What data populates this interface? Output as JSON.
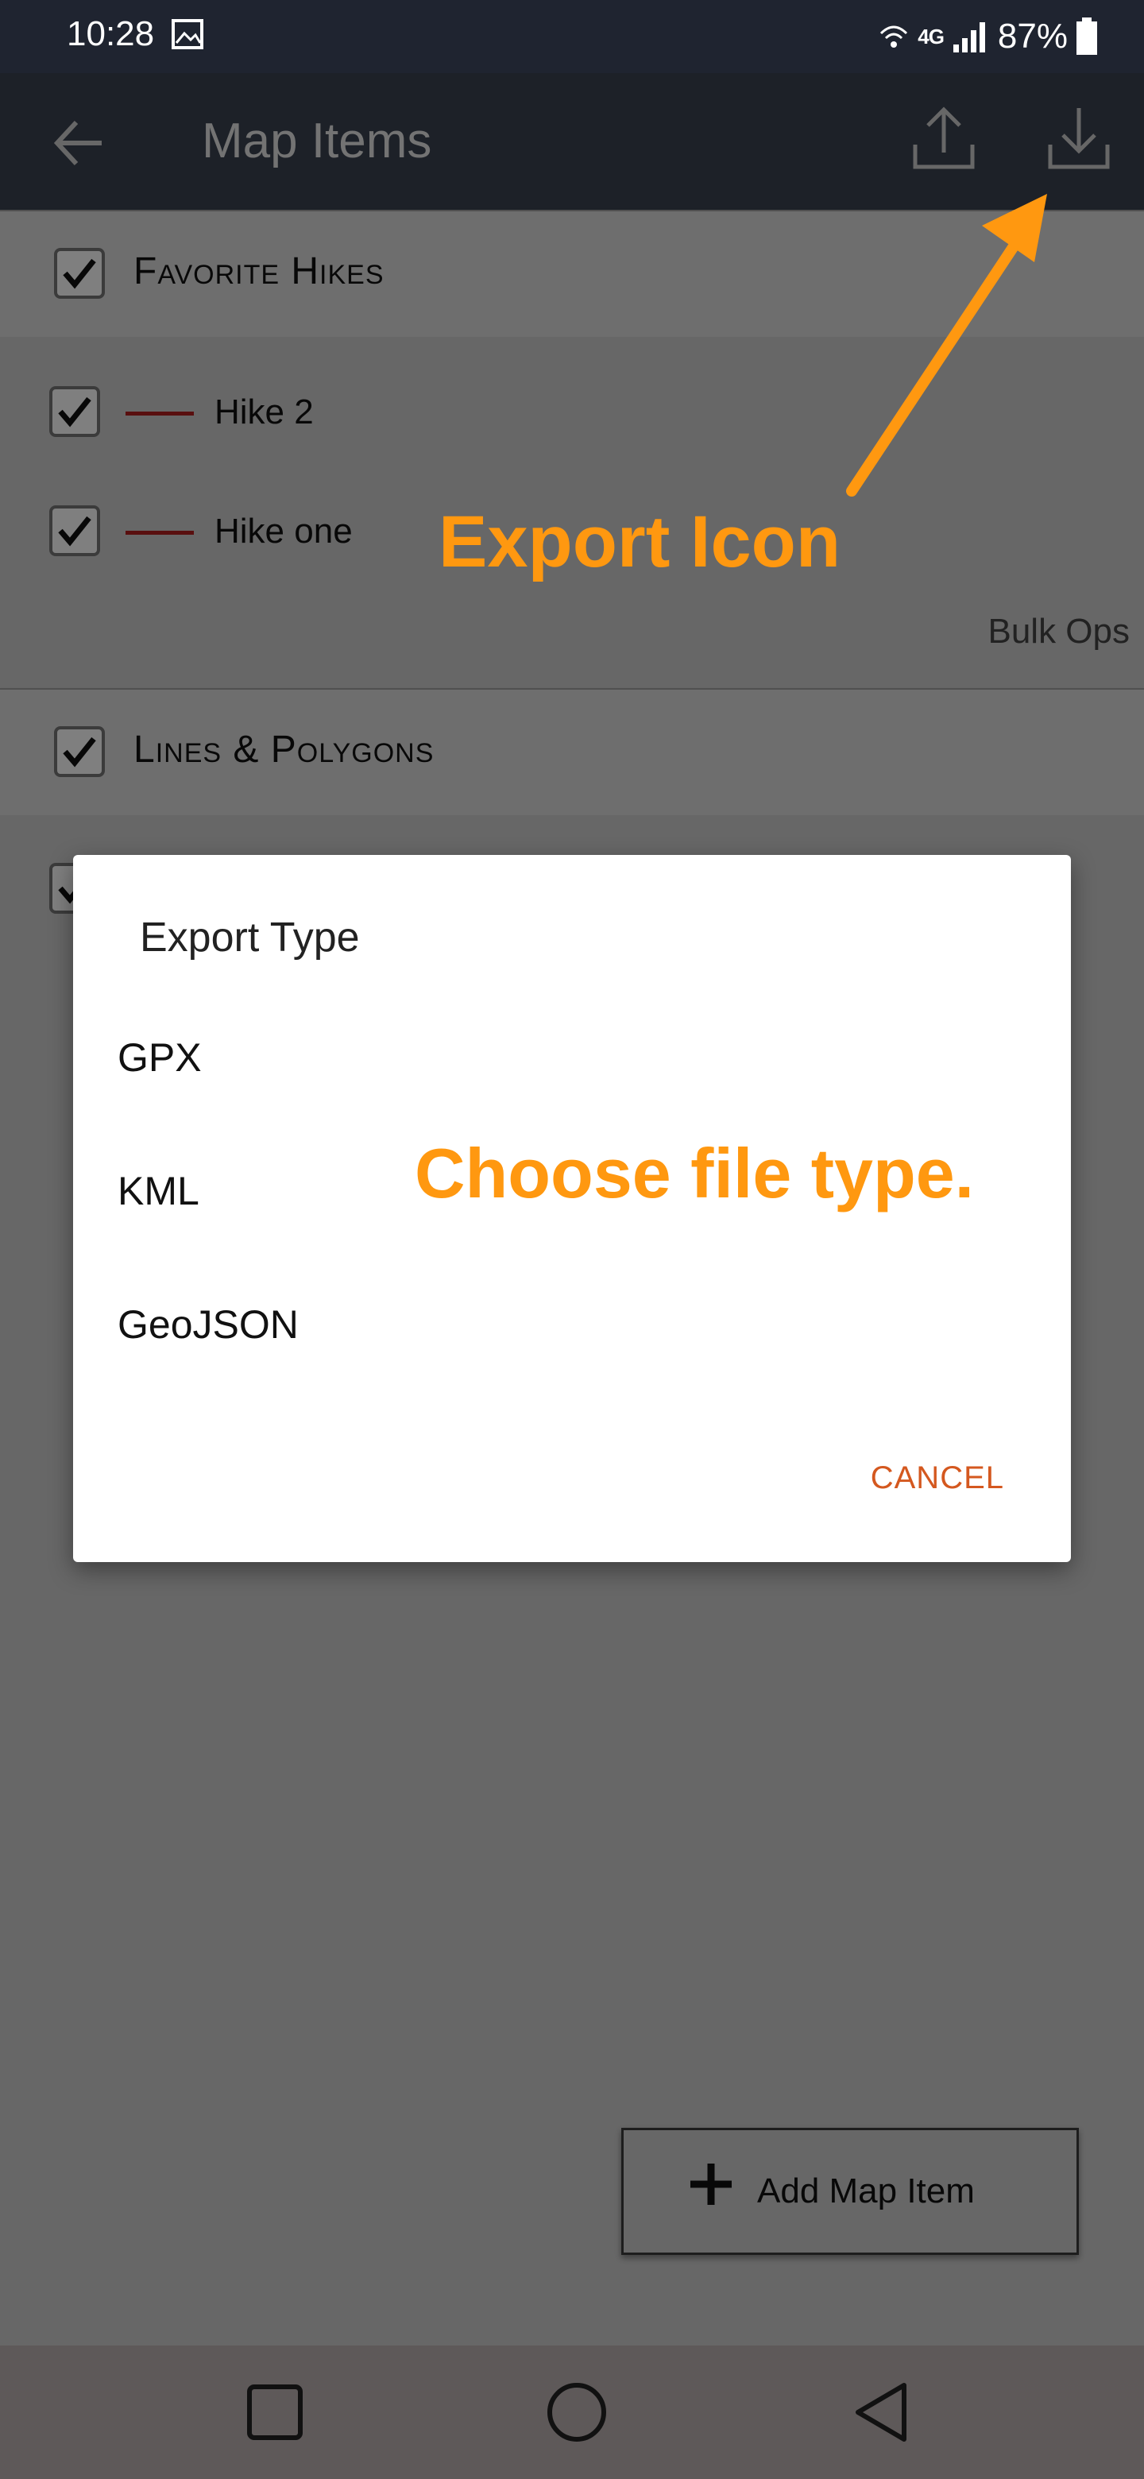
{
  "status_bar": {
    "time": "10:28",
    "network": "4G",
    "battery_percent": "87%",
    "icons": [
      "image-icon",
      "wifi-icon",
      "signal-icon",
      "battery-icon"
    ]
  },
  "app_bar": {
    "title": "Map Items",
    "icons": [
      "back-arrow-icon",
      "upload-icon",
      "download-icon"
    ]
  },
  "sections": [
    {
      "label": "Favorite Hikes",
      "checked": true,
      "items": [
        {
          "label": "Hike 2",
          "checked": true,
          "line_color": "#b21f1f"
        },
        {
          "label": "Hike one",
          "checked": true,
          "line_color": "#b21f1f"
        }
      ],
      "bulk_ops": "Bulk Ops"
    },
    {
      "label": "Lines & Polygons",
      "checked": true
    }
  ],
  "dialog": {
    "title": "Export Type",
    "options": [
      "GPX",
      "KML",
      "GeoJSON"
    ],
    "cancel_label": "CANCEL"
  },
  "add_button": {
    "label": "Add Map Item",
    "icon": "plus-icon"
  },
  "annotations": {
    "export_icon": "Export Icon",
    "choose_file_type": "Choose file type.",
    "color": "#ff9810"
  },
  "nav_bar": {
    "icons": [
      "recent-apps-icon",
      "home-icon",
      "back-icon"
    ]
  }
}
